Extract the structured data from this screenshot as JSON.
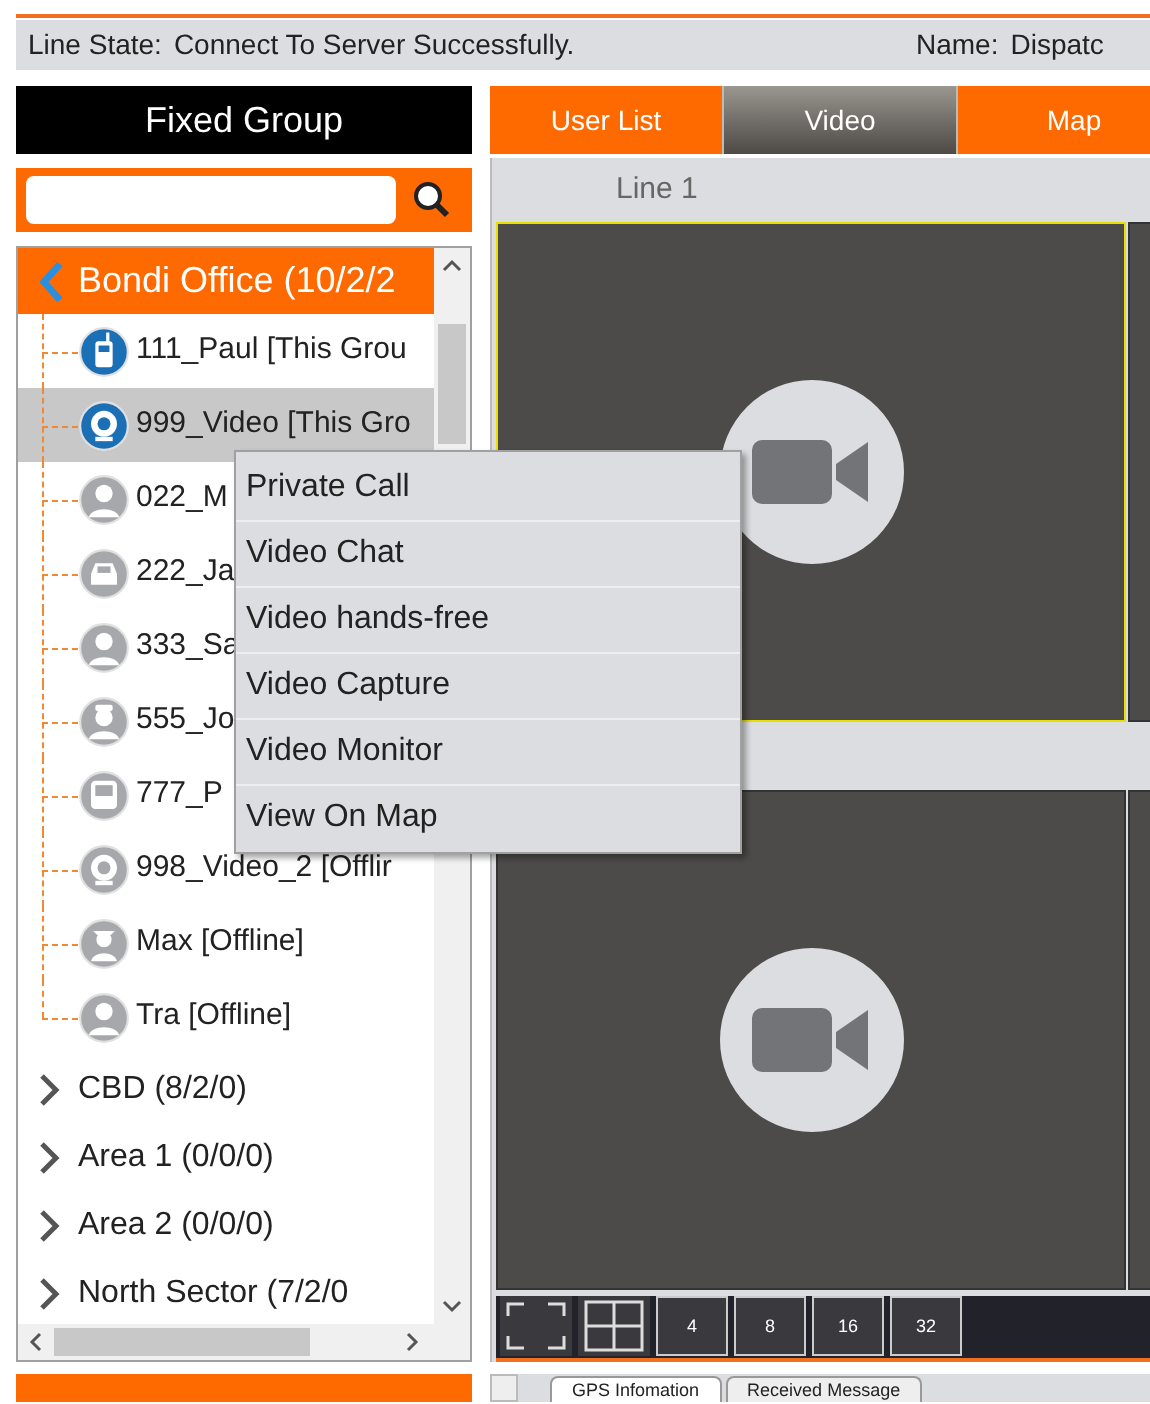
{
  "status_bar": {
    "fields": [
      {
        "label": "Line State:",
        "value": "Connect To Server Successfully."
      },
      {
        "label": "Name:",
        "value": "Dispatc"
      }
    ]
  },
  "left_panel": {
    "title": "Fixed Group"
  },
  "tree": [
    {
      "label": "Bondi Office (10/2/2",
      "expanded": true,
      "children": [
        {
          "label": "111_Paul [This Grou",
          "kind": "radio",
          "online": true,
          "selected": false
        },
        {
          "label": "999_Video [This Gro",
          "kind": "webcam",
          "online": true,
          "selected": true
        },
        {
          "label": "022_M",
          "kind": "person",
          "online": false,
          "selected": false
        },
        {
          "label": "222_Ja",
          "kind": "car",
          "online": false,
          "selected": false
        },
        {
          "label": "333_Sa",
          "kind": "person",
          "online": false,
          "selected": false
        },
        {
          "label": "555_Jo",
          "kind": "cap",
          "online": false,
          "selected": false
        },
        {
          "label": "777_P",
          "kind": "bus",
          "online": false,
          "selected": false
        },
        {
          "label": "998_Video_2 [Offlir",
          "kind": "webcam",
          "online": false,
          "selected": false
        },
        {
          "label": "Max [Offline]",
          "kind": "hat",
          "online": false,
          "selected": false
        },
        {
          "label": "Tra [Offline]",
          "kind": "person",
          "online": false,
          "selected": false
        }
      ]
    },
    {
      "label": "CBD (8/2/0)",
      "expanded": false
    },
    {
      "label": "Area 1 (0/0/0)",
      "expanded": false
    },
    {
      "label": "Area 2 (0/0/0)",
      "expanded": false
    },
    {
      "label": "North Sector (7/2/0",
      "expanded": false
    }
  ],
  "tabs": [
    {
      "label": "User List",
      "selected": false
    },
    {
      "label": "Video",
      "selected": true
    },
    {
      "label": "Map",
      "selected": false
    }
  ],
  "video": {
    "line_label": "Line 1",
    "cells": [
      {
        "selected": true
      },
      {
        "selected": false
      }
    ],
    "layout_buttons": [
      "4",
      "8",
      "16",
      "32"
    ]
  },
  "context_menu": [
    "Private Call",
    "Video Chat",
    "Video hands-free",
    "Video Capture",
    "Video Monitor",
    "View On Map"
  ],
  "bottom_tabs": [
    {
      "label": "GPS Infomation",
      "selected": true
    },
    {
      "label": "Received Message",
      "selected": false
    }
  ]
}
